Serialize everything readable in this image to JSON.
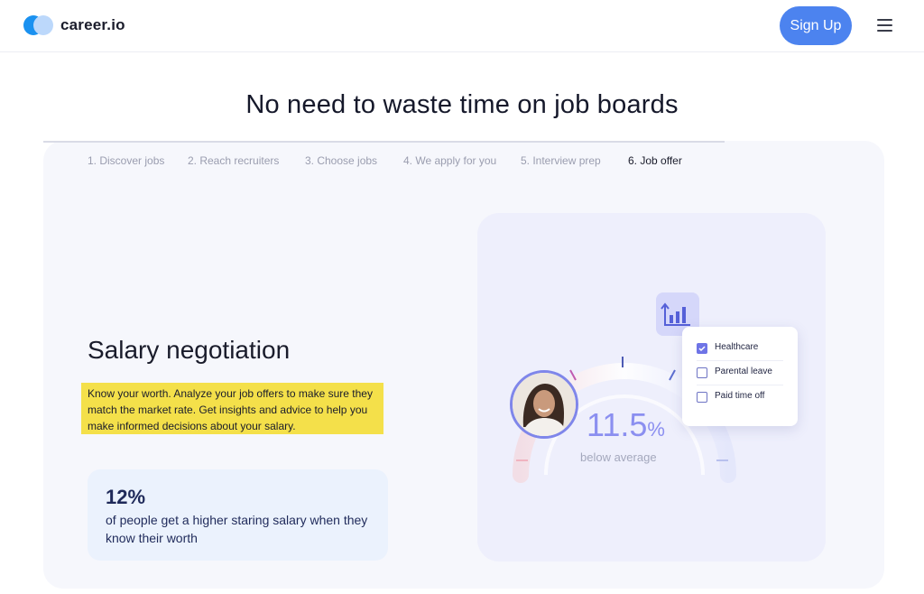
{
  "header": {
    "brand": "career.io",
    "signup_label": "Sign Up",
    "menu_icon": "hamburger-menu-icon",
    "accent_color": "#4c83ef"
  },
  "page": {
    "title": "No need to waste time on job boards"
  },
  "steps": {
    "items": [
      {
        "label": "1. Discover jobs",
        "active": false
      },
      {
        "label": "2. Reach recruiters",
        "active": false
      },
      {
        "label": "3. Choose jobs",
        "active": false
      },
      {
        "label": "4. We apply for you",
        "active": false
      },
      {
        "label": "5. Interview prep",
        "active": false
      },
      {
        "label": "6. Job offer",
        "active": true
      }
    ],
    "progress_fraction": 0.81
  },
  "feature": {
    "title": "Salary negotiation",
    "description": "Know your worth. Analyze your job offers to make sure they match the market rate. Get insights and advice to help you make informed decisions about your salary.",
    "highlight_color": "#f4e04a"
  },
  "stat": {
    "value": "12%",
    "text": "of people get a higher staring salary when they know their worth"
  },
  "illustration": {
    "value": "11.5",
    "unit": "%",
    "caption": "below average",
    "chart_icon": "bar-chart-growth-icon",
    "checklist": [
      {
        "label": "Healthcare",
        "checked": true
      },
      {
        "label": "Parental leave",
        "checked": false
      },
      {
        "label": "Paid time off",
        "checked": false
      }
    ]
  }
}
